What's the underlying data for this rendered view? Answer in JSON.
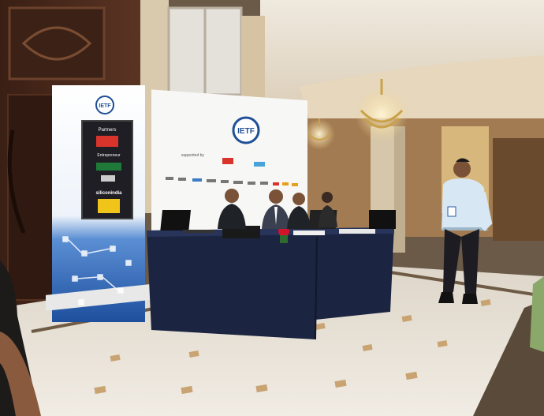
{
  "photo": {
    "left_banner": {
      "logo": "IETF",
      "partners_heading": "Partners",
      "partner_logos": [
        "",
        "Entrepreneur",
        "",
        "",
        "siliconindia",
        ""
      ]
    },
    "backdrop": {
      "logo": "IETF",
      "supported_by": "supported by",
      "sponsor_strip": [
        "",
        "",
        "",
        "",
        "",
        "",
        "",
        "",
        "",
        "",
        ""
      ]
    },
    "colors": {
      "banner_blue": "#1f5fb5",
      "table_cloth": "#1b2440",
      "floor": "#ece6dc",
      "wood_wall": "#4a2a1c"
    }
  }
}
